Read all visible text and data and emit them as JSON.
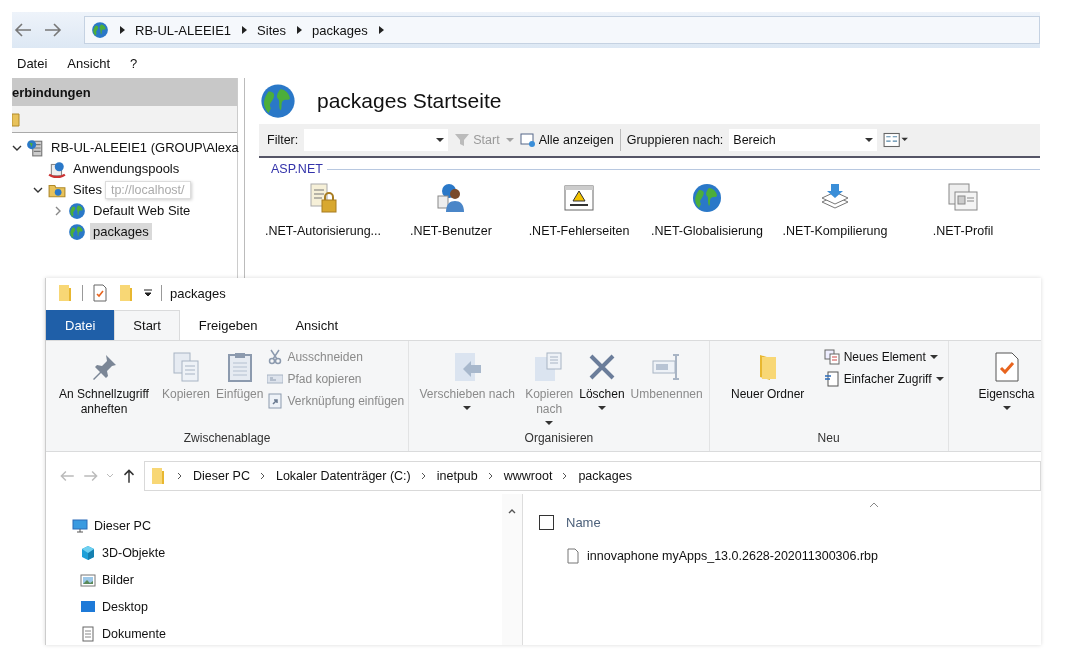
{
  "iis": {
    "address": {
      "segments": [
        "RB-UL-ALEEIE1",
        "Sites",
        "packages"
      ]
    },
    "menu": [
      "Datei",
      "Ansicht",
      "?"
    ],
    "connections": {
      "title": "erbindungen",
      "tree": [
        {
          "label": "RB-UL-ALEEIE1 (GROUP\\Alexa",
          "expanded": true,
          "selected": false,
          "children": [
            {
              "label": "Anwendungspools",
              "selected": false
            },
            {
              "label": "Sites",
              "expanded": true,
              "selected": false,
              "tooltip": "tp://localhost/",
              "children": [
                {
                  "label": "Default Web Site",
                  "expanded": false,
                  "selected": false
                },
                {
                  "label": "packages",
                  "selected": true
                }
              ]
            }
          ]
        }
      ]
    },
    "content": {
      "title": "packages Startseite",
      "filter": {
        "label": "Filter:"
      },
      "start": {
        "label": "Start",
        "disabled": true
      },
      "show_all": {
        "label": "Alle anzeigen"
      },
      "group_by": {
        "label": "Gruppieren nach:",
        "value": "Bereich"
      },
      "section": "ASP.NET",
      "features": [
        {
          "label": ".NET-Autorisierung..."
        },
        {
          "label": ".NET-Benutzer"
        },
        {
          "label": ".NET-Fehlerseiten"
        },
        {
          "label": ".NET-Globalisierung"
        },
        {
          "label": ".NET-Kompilierung"
        },
        {
          "label": ".NET-Profil"
        }
      ]
    }
  },
  "explorer": {
    "title": "packages",
    "tabs": [
      {
        "label": "Datei",
        "kind": "file",
        "selected": false
      },
      {
        "label": "Start",
        "kind": "tab",
        "selected": true
      },
      {
        "label": "Freigeben",
        "kind": "tab",
        "selected": false
      },
      {
        "label": "Ansicht",
        "kind": "tab",
        "selected": false
      }
    ],
    "groups": [
      {
        "label": "Zwischenablage",
        "items": [
          {
            "kind": "big",
            "label": "An Schnellzugriff anheften",
            "disabled": false
          },
          {
            "kind": "big",
            "label": "Kopieren",
            "disabled": true
          },
          {
            "kind": "big",
            "label": "Einfügen",
            "disabled": true
          },
          {
            "kind": "stack",
            "items": [
              {
                "label": "Ausschneiden",
                "disabled": true
              },
              {
                "label": "Pfad kopieren",
                "disabled": true
              },
              {
                "label": "Verknüpfung einfügen",
                "disabled": true
              }
            ]
          }
        ]
      },
      {
        "label": "Organisieren",
        "items": [
          {
            "kind": "big",
            "label": "Verschieben nach",
            "disabled": true,
            "dropdown": true
          },
          {
            "kind": "big",
            "label": "Kopieren nach",
            "disabled": true,
            "dropdown": true
          },
          {
            "kind": "big",
            "label": "Löschen",
            "disabled": false,
            "dropdown": true
          },
          {
            "kind": "big",
            "label": "Umbenennen",
            "disabled": true
          }
        ]
      },
      {
        "label": "Neu",
        "items": [
          {
            "kind": "big",
            "label": "Neuer Ordner",
            "disabled": false
          },
          {
            "kind": "stack",
            "items": [
              {
                "label": "Neues Element",
                "disabled": false,
                "dropdown": true
              },
              {
                "label": "Einfacher Zugriff",
                "disabled": false,
                "dropdown": true
              }
            ]
          }
        ]
      },
      {
        "items": [
          {
            "kind": "big",
            "label": "Eigenscha",
            "disabled": false,
            "dropdown": true
          }
        ]
      }
    ],
    "address": [
      "Dieser PC",
      "Lokaler Datenträger (C:)",
      "inetpub",
      "wwwroot",
      "packages"
    ],
    "nav": [
      {
        "label": "Dieser PC"
      },
      {
        "label": "3D-Objekte"
      },
      {
        "label": "Bilder"
      },
      {
        "label": "Desktop"
      },
      {
        "label": "Dokumente"
      }
    ],
    "list": {
      "select_all": {
        "checked": false
      },
      "columns": [
        "Name"
      ]
    },
    "files": [
      {
        "name": "innovaphone myApps_13.0.2628-202011300306.rbp",
        "selected": false
      }
    ]
  }
}
